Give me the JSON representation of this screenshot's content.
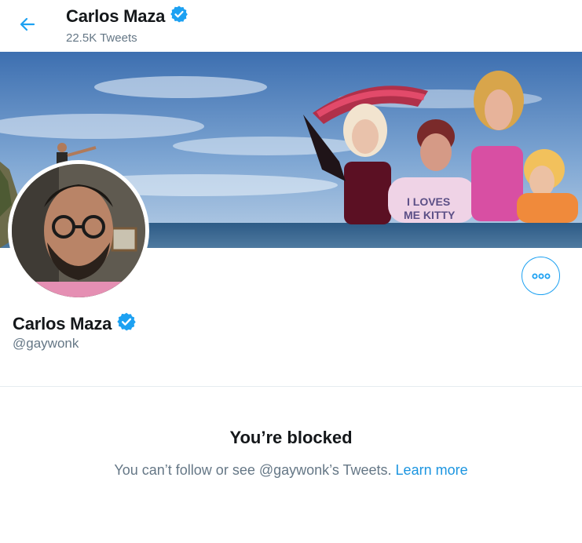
{
  "header": {
    "back_icon": "arrow-left-icon",
    "name": "Carlos Maza",
    "tweet_count": "22.5K Tweets",
    "verified_icon": "verified-badge-icon"
  },
  "banner": {
    "shirt_text_line1": "I LOVES",
    "shirt_text_line2": "ME KITTY"
  },
  "profile": {
    "name": "Carlos Maza",
    "handle": "@gaywonk",
    "more_icon": "more-options-icon"
  },
  "blocked": {
    "title": "You’re blocked",
    "message": "You can’t follow or see @gaywonk’s Tweets.",
    "link": "Learn more"
  },
  "colors": {
    "accent": "#1da1f2",
    "link": "#1b95e0",
    "muted": "#657786",
    "text": "#14171a"
  }
}
